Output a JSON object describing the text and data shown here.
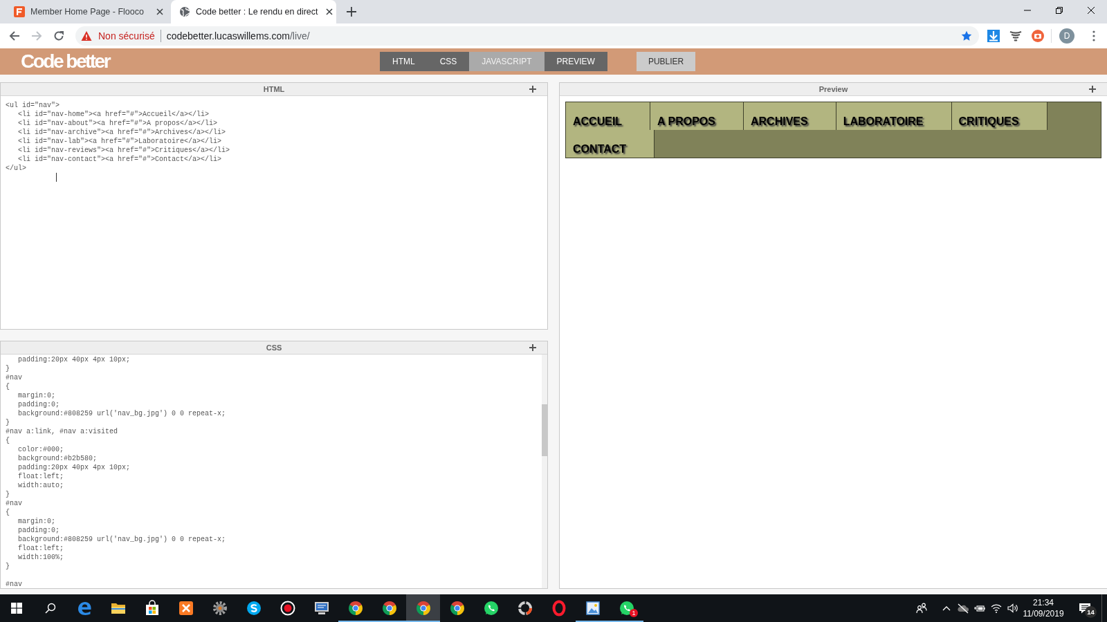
{
  "browser": {
    "tabs": [
      {
        "title": "Member Home Page - Flooco",
        "selected": false
      },
      {
        "title": "Code better : Le rendu en direct",
        "selected": true
      }
    ],
    "forward_button": {
      "disabled": true
    },
    "address_bar": {
      "security_label": "Non sécurisé",
      "host": "codebetter.lucaswillems.com",
      "path": "/live/",
      "bookmarked": true
    },
    "profile_initial": "D"
  },
  "app_header": {
    "logo": "Code better",
    "panel_toggles": [
      {
        "label": "HTML",
        "on": true
      },
      {
        "label": "CSS",
        "on": true
      },
      {
        "label": "JAVASCRIPT",
        "on": false
      },
      {
        "label": "PREVIEW",
        "on": true
      }
    ],
    "publish_button": "PUBLIER"
  },
  "html_editor": {
    "title": "HTML",
    "code": "<ul id=\"nav\">\n   <li id=\"nav-home\"><a href=\"#\">Accueil</a></li>\n   <li id=\"nav-about\"><a href=\"#\">A propos</a></li>\n   <li id=\"nav-archive\"><a href=\"#\">Archives</a></li>\n   <li id=\"nav-lab\"><a href=\"#\">Laboratoire</a></li>\n   <li id=\"nav-reviews\"><a href=\"#\">Critiques</a></li>\n   <li id=\"nav-contact\"><a href=\"#\">Contact</a></li>\n</ul>"
  },
  "css_editor": {
    "title": "CSS",
    "code": "   padding:20px 40px 4px 10px;\n}\n#nav\n{\n   margin:0;\n   padding:0;\n   background:#808259 url('nav_bg.jpg') 0 0 repeat-x;\n}\n#nav a:link, #nav a:visited\n{\n   color:#000;\n   background:#b2b580;\n   padding:20px 40px 4px 10px;\n   float:left;\n   width:auto;\n}\n#nav\n{\n   margin:0;\n   padding:0;\n   background:#808259 url('nav_bg.jpg') 0 0 repeat-x;\n   float:left;\n   width:100%;\n}\n\n#nav"
  },
  "preview": {
    "title": "Preview",
    "nav_items": [
      "ACCUEIL",
      "A PROPOS",
      "ARCHIVES",
      "LABORATOIRE",
      "CRITIQUES",
      "CONTACT"
    ]
  },
  "taskbar": {
    "apps": [
      {
        "kind": "edge",
        "running": false,
        "selected": false
      },
      {
        "kind": "folder",
        "running": false,
        "selected": false
      },
      {
        "kind": "store",
        "running": false,
        "selected": false
      },
      {
        "kind": "xampp",
        "running": false,
        "selected": false
      },
      {
        "kind": "gear",
        "running": false,
        "selected": false
      },
      {
        "kind": "skype",
        "running": false,
        "selected": false
      },
      {
        "kind": "record",
        "running": false,
        "selected": false
      },
      {
        "kind": "monitor",
        "running": false,
        "selected": false
      },
      {
        "kind": "chrome",
        "running": true,
        "selected": false
      },
      {
        "kind": "chrome",
        "running": true,
        "selected": false
      },
      {
        "kind": "chrome",
        "running": true,
        "selected": true
      },
      {
        "kind": "chrome",
        "running": false,
        "selected": false
      },
      {
        "kind": "whatsapp",
        "running": false,
        "selected": false
      },
      {
        "kind": "ring",
        "running": false,
        "selected": false
      },
      {
        "kind": "opera",
        "running": false,
        "selected": false
      },
      {
        "kind": "picture",
        "running": true,
        "selected": false
      },
      {
        "kind": "whatsapp",
        "running": true,
        "selected": false,
        "badge": "1"
      }
    ],
    "time": "21:34",
    "date": "11/09/2019",
    "notification_count": "14"
  }
}
